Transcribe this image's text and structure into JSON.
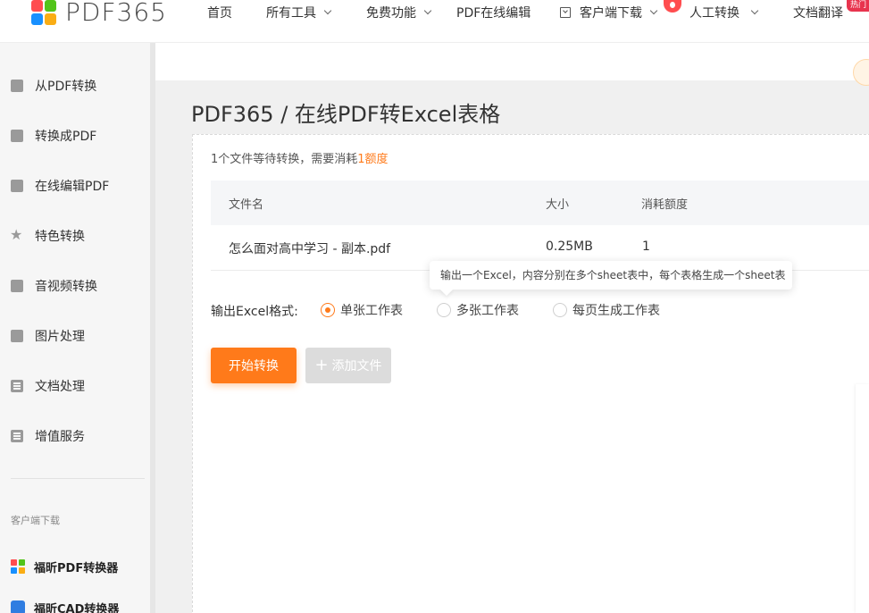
{
  "logo": {
    "text": "PDF365"
  },
  "nav": {
    "home": "首页",
    "all_tools": "所有工具",
    "free": "免费功能",
    "online_edit": "PDF在线编辑",
    "client_download": "客户端下载",
    "manual": "人工转换",
    "translate": "文档翻译",
    "hot_badge": "热门"
  },
  "sidebar": {
    "items": [
      {
        "label": "从PDF转换",
        "icon": "file-out-icon"
      },
      {
        "label": "转换成PDF",
        "icon": "file-in-icon"
      },
      {
        "label": "在线编辑PDF",
        "icon": "edit-icon"
      },
      {
        "label": "特色转换",
        "icon": "star-icon"
      },
      {
        "label": "音视频转换",
        "icon": "video-icon"
      },
      {
        "label": "图片处理",
        "icon": "image-icon"
      },
      {
        "label": "文档处理",
        "icon": "document-icon"
      },
      {
        "label": "增值服务",
        "icon": "list-icon"
      }
    ],
    "caption": "客户端下载",
    "apps": [
      {
        "label": "福昕PDF转换器",
        "icon": "foxit-pdf-icon"
      },
      {
        "label": "福昕CAD转换器",
        "icon": "foxit-cad-icon"
      }
    ]
  },
  "main": {
    "title": "PDF365 / 在线PDF转Excel表格",
    "pending_prefix": "1个文件等待转换，需要消耗",
    "pending_highlight": "1额度",
    "table": {
      "headers": [
        "文件名",
        "大小",
        "消耗额度"
      ],
      "rows": [
        {
          "name": "怎么面对高中学习 - 副本.pdf",
          "size": "0.25MB",
          "cost": "1"
        }
      ]
    },
    "tooltip": "输出一个Excel，内容分别在多个sheet表中，每个表格生成一个sheet表",
    "format_label": "输出Excel格式:",
    "format_options": [
      "单张工作表",
      "多张工作表",
      "每页生成工作表"
    ],
    "format_selected": "单张工作表",
    "start_button": "开始转换",
    "add_button": "添加文件"
  },
  "colors": {
    "accent": "#ff7a1a",
    "disabled": "#dcdcdc"
  }
}
